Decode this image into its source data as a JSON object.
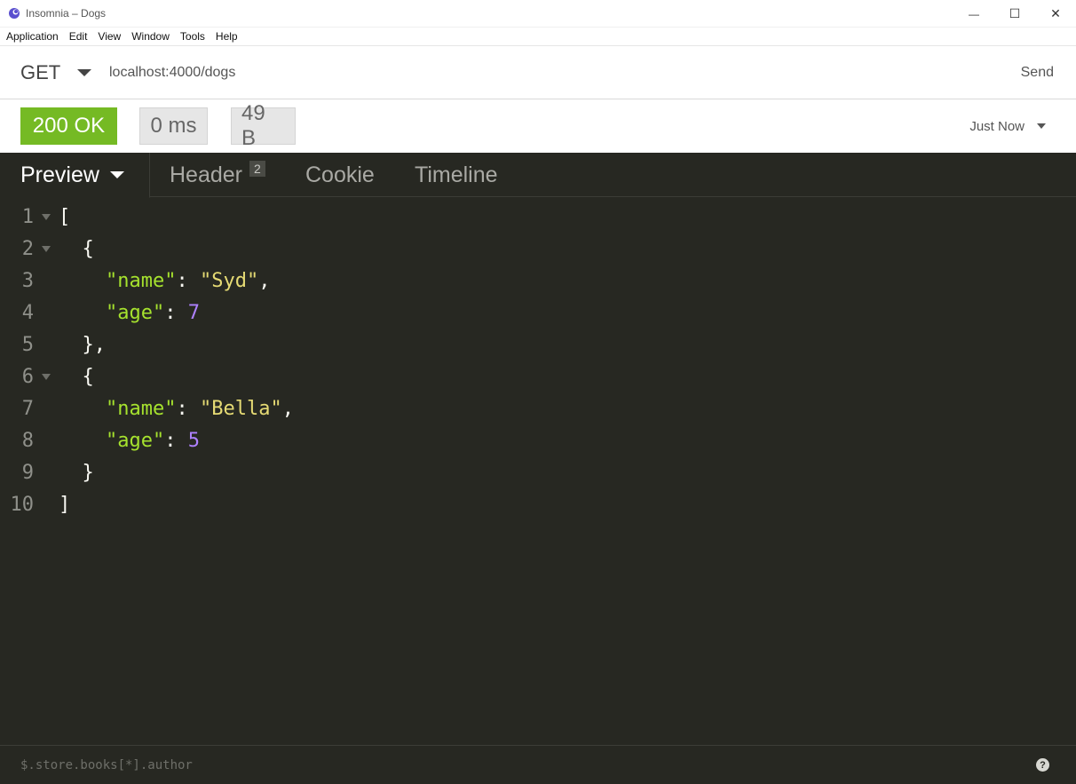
{
  "window": {
    "title": "Insomnia – Dogs",
    "minimize_glyph": "—",
    "maximize_glyph": "☐",
    "close_glyph": "✕"
  },
  "menu": [
    "Application",
    "Edit",
    "View",
    "Window",
    "Tools",
    "Help"
  ],
  "request": {
    "method": "GET",
    "url": "localhost:4000/dogs",
    "send_label": "Send"
  },
  "response": {
    "status": "200 OK",
    "time": "0 ms",
    "size": "49 B",
    "history": "Just Now"
  },
  "tabs": {
    "preview": "Preview",
    "header": "Header",
    "header_count": "2",
    "cookie": "Cookie",
    "timeline": "Timeline"
  },
  "code_lines": [
    {
      "num": "1",
      "fold": true
    },
    {
      "num": "2",
      "fold": true
    },
    {
      "num": "3",
      "fold": false
    },
    {
      "num": "4",
      "fold": false
    },
    {
      "num": "5",
      "fold": false
    },
    {
      "num": "6",
      "fold": true
    },
    {
      "num": "7",
      "fold": false
    },
    {
      "num": "8",
      "fold": false
    },
    {
      "num": "9",
      "fold": false
    },
    {
      "num": "10",
      "fold": false
    }
  ],
  "json_body": {
    "dogs": [
      {
        "key_name": "\"name\"",
        "name": "\"Syd\"",
        "key_age": "\"age\"",
        "age": "7"
      },
      {
        "key_name": "\"name\"",
        "name": "\"Bella\"",
        "key_age": "\"age\"",
        "age": "5"
      }
    ]
  },
  "filter": {
    "placeholder": "$.store.books[*].author"
  },
  "help_glyph": "?",
  "colors": {
    "status_ok": "#75ba24",
    "editor_bg": "#272822",
    "json_key": "#a6e22e",
    "json_string": "#e6db74",
    "json_number": "#ae81ff",
    "app_icon": "#5a4fcf"
  }
}
